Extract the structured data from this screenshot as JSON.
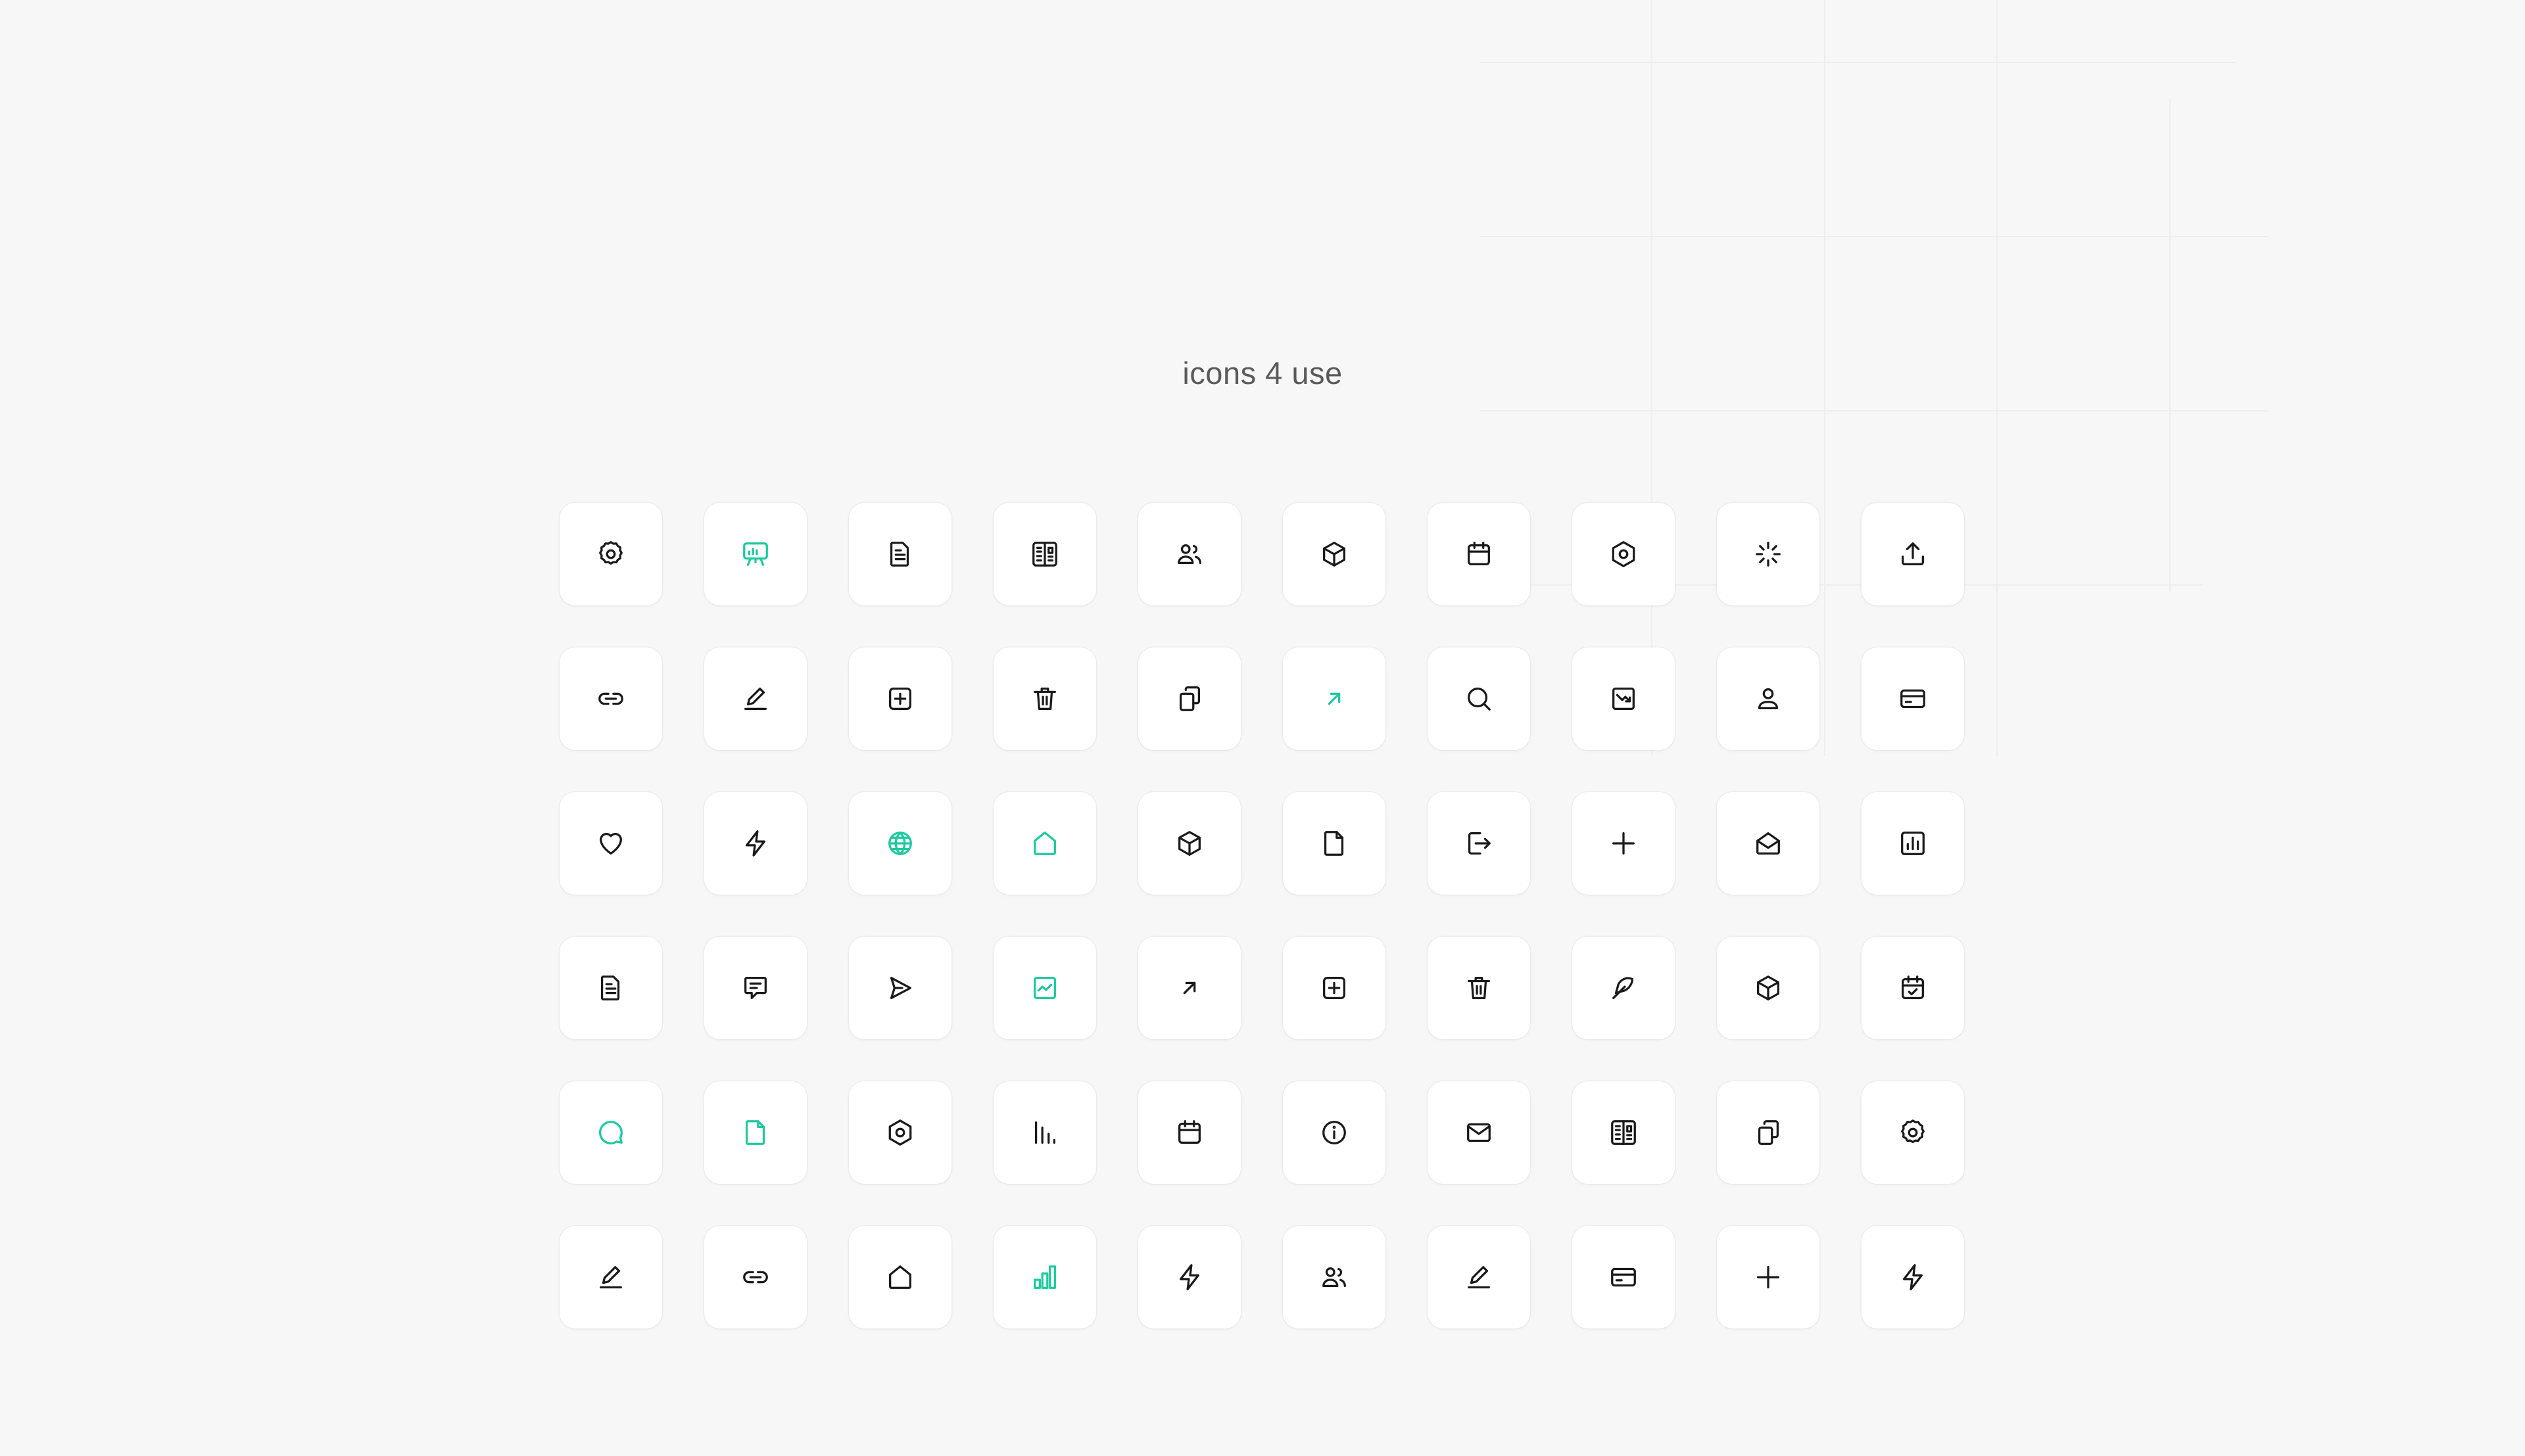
{
  "title": "icons 4 use",
  "colors": {
    "background": "#f7f7f7",
    "tile": "#ffffff",
    "icon_default": "#1a1a1a",
    "icon_accent": "#1ec99f",
    "title": "#5a5a5a"
  },
  "icons": [
    [
      {
        "name": "gear-icon",
        "accent": false
      },
      {
        "name": "presentation-icon",
        "accent": true
      },
      {
        "name": "document-icon",
        "accent": false
      },
      {
        "name": "newspaper-icon",
        "accent": false
      },
      {
        "name": "users-icon",
        "accent": false
      },
      {
        "name": "cube-icon",
        "accent": false
      },
      {
        "name": "calendar-icon",
        "accent": false
      },
      {
        "name": "hexagon-icon",
        "accent": false
      },
      {
        "name": "loader-icon",
        "accent": false
      },
      {
        "name": "upload-icon",
        "accent": false
      }
    ],
    [
      {
        "name": "link-icon",
        "accent": false
      },
      {
        "name": "pen-icon",
        "accent": false
      },
      {
        "name": "plus-square-icon",
        "accent": false
      },
      {
        "name": "trash-icon",
        "accent": false
      },
      {
        "name": "copy-icon",
        "accent": false
      },
      {
        "name": "arrow-up-right-icon",
        "accent": true
      },
      {
        "name": "search-icon",
        "accent": false
      },
      {
        "name": "trend-down-icon",
        "accent": false
      },
      {
        "name": "user-icon",
        "accent": false
      },
      {
        "name": "credit-card-icon",
        "accent": false
      }
    ],
    [
      {
        "name": "heart-icon",
        "accent": false
      },
      {
        "name": "lightning-icon",
        "accent": false
      },
      {
        "name": "globe-icon",
        "accent": true
      },
      {
        "name": "home-icon",
        "accent": true
      },
      {
        "name": "cube-icon",
        "accent": false
      },
      {
        "name": "file-icon",
        "accent": false
      },
      {
        "name": "logout-icon",
        "accent": false
      },
      {
        "name": "plus-icon",
        "accent": false
      },
      {
        "name": "mail-open-icon",
        "accent": false
      },
      {
        "name": "bar-chart-square-icon",
        "accent": false
      }
    ],
    [
      {
        "name": "document-icon",
        "accent": false
      },
      {
        "name": "chat-icon",
        "accent": false
      },
      {
        "name": "send-icon",
        "accent": false
      },
      {
        "name": "activity-chart-icon",
        "accent": true
      },
      {
        "name": "arrow-up-right-icon",
        "accent": false
      },
      {
        "name": "plus-square-icon",
        "accent": false
      },
      {
        "name": "trash-icon",
        "accent": false
      },
      {
        "name": "feather-icon",
        "accent": false
      },
      {
        "name": "cube-icon",
        "accent": false
      },
      {
        "name": "calendar-check-icon",
        "accent": false
      }
    ],
    [
      {
        "name": "message-circle-icon",
        "accent": true
      },
      {
        "name": "file-icon",
        "accent": true
      },
      {
        "name": "hexagon-icon",
        "accent": false
      },
      {
        "name": "bar-chart-icon",
        "accent": false
      },
      {
        "name": "calendar-icon",
        "accent": false
      },
      {
        "name": "info-icon",
        "accent": false
      },
      {
        "name": "mail-icon",
        "accent": false
      },
      {
        "name": "newspaper-icon",
        "accent": false
      },
      {
        "name": "copy-icon",
        "accent": false
      },
      {
        "name": "gear-icon",
        "accent": false
      }
    ],
    [
      {
        "name": "pen-icon",
        "accent": false
      },
      {
        "name": "link-icon",
        "accent": false
      },
      {
        "name": "home-icon",
        "accent": false
      },
      {
        "name": "signal-chart-icon",
        "accent": true
      },
      {
        "name": "lightning-icon",
        "accent": false
      },
      {
        "name": "users-icon",
        "accent": false
      },
      {
        "name": "pen-icon",
        "accent": false
      },
      {
        "name": "credit-card-icon",
        "accent": false
      },
      {
        "name": "plus-icon",
        "accent": false
      },
      {
        "name": "lightning-icon",
        "accent": false
      }
    ]
  ]
}
